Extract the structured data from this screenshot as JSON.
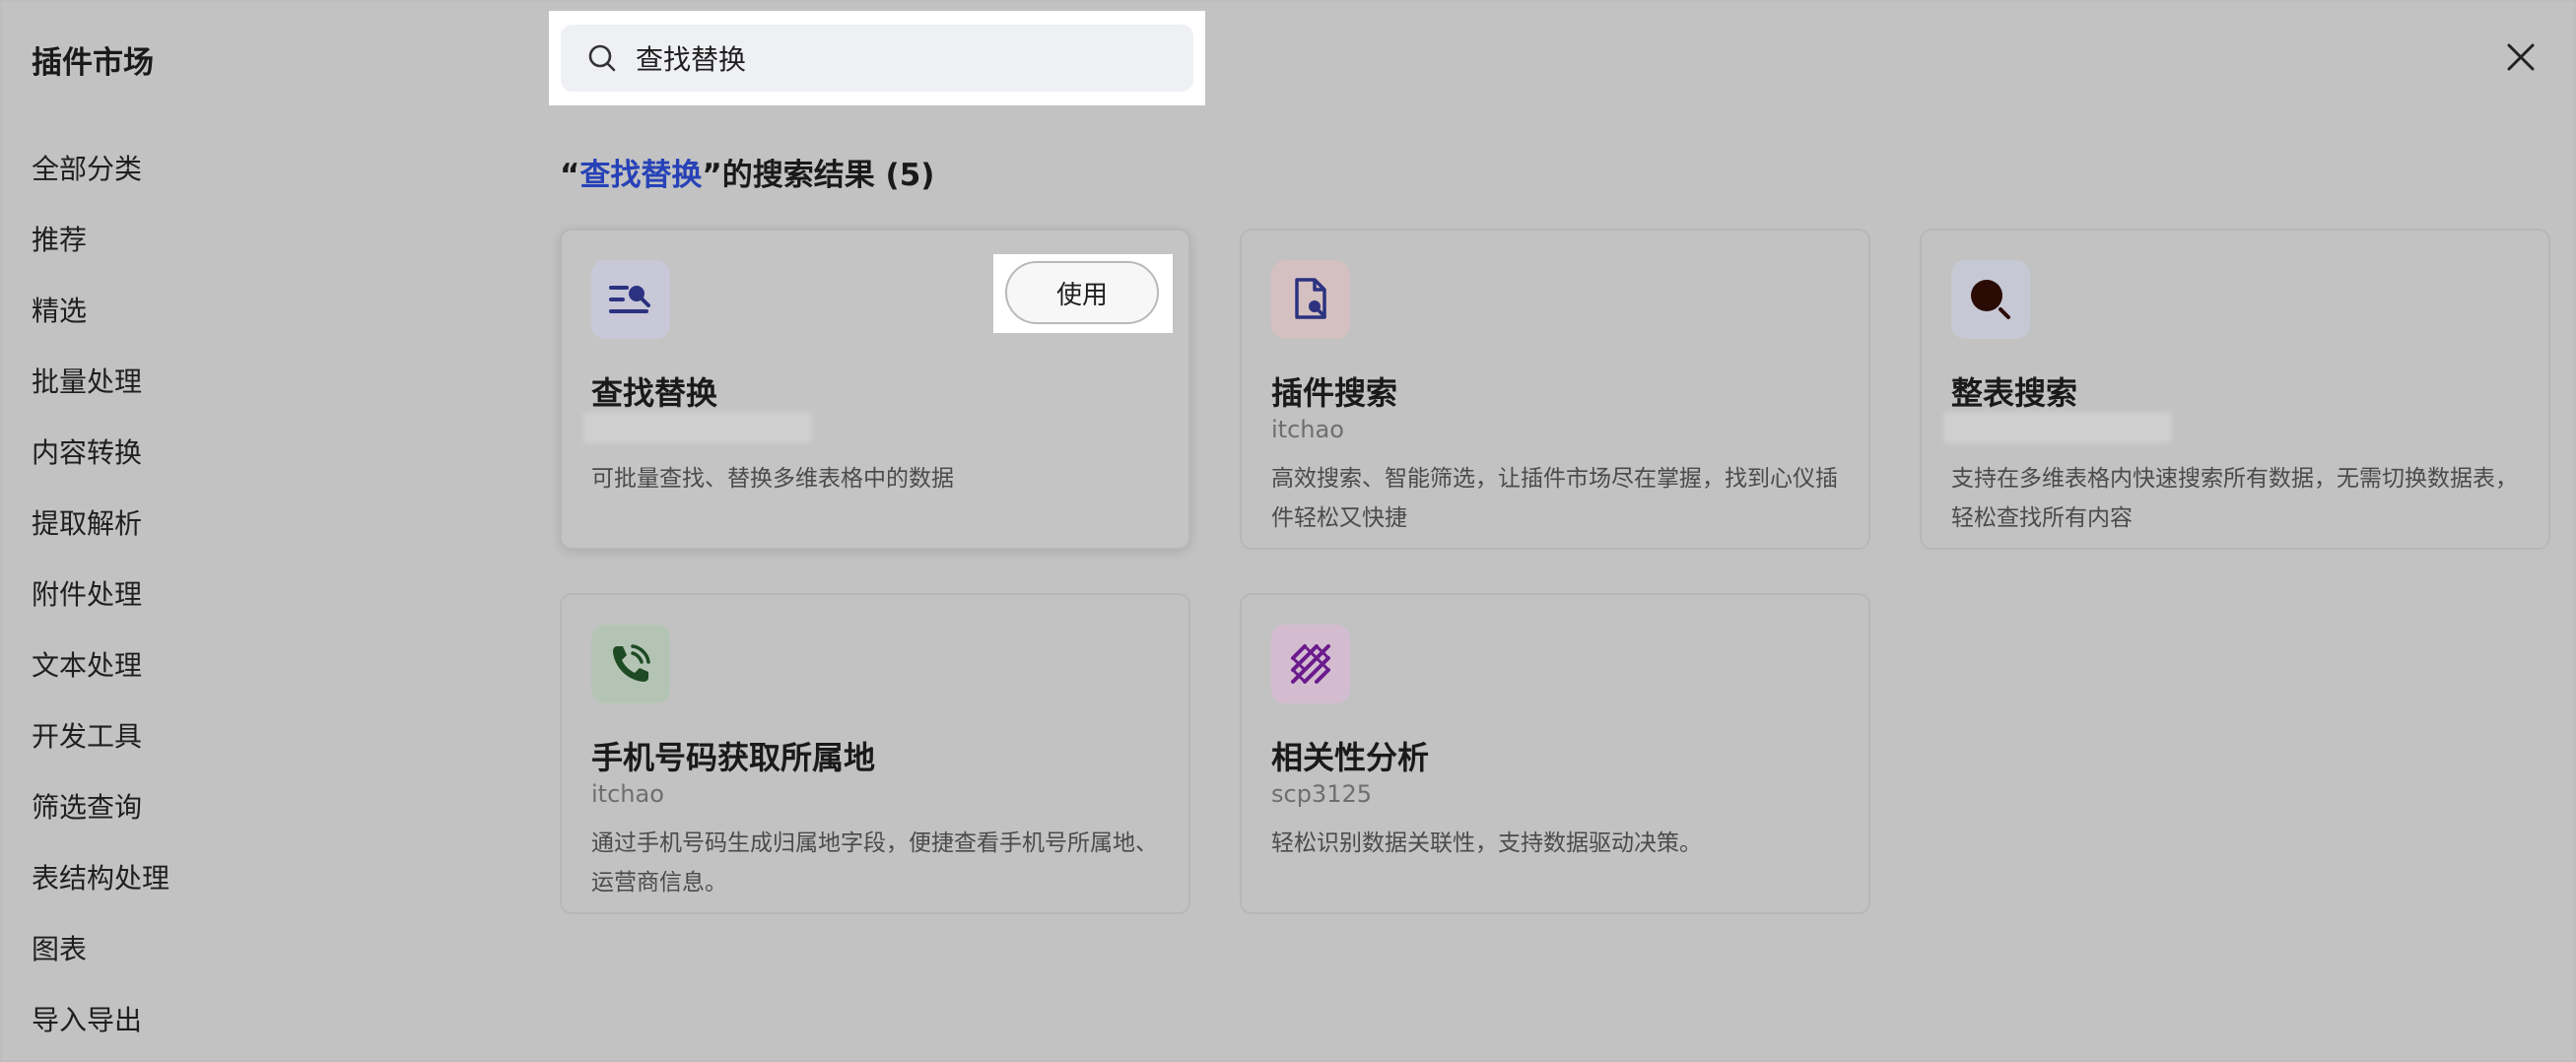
{
  "app": {
    "title": "插件市场"
  },
  "search": {
    "value": "查找替换"
  },
  "sidebar": {
    "items": [
      {
        "label": "全部分类"
      },
      {
        "label": "推荐"
      },
      {
        "label": "精选"
      },
      {
        "label": "批量处理"
      },
      {
        "label": "内容转换"
      },
      {
        "label": "提取解析"
      },
      {
        "label": "附件处理"
      },
      {
        "label": "文本处理"
      },
      {
        "label": "开发工具"
      },
      {
        "label": "筛选查询"
      },
      {
        "label": "表结构处理"
      },
      {
        "label": "图表"
      },
      {
        "label": "导入导出"
      }
    ]
  },
  "results": {
    "open_quote": "“",
    "keyword": "查找替换",
    "suffix": "”的搜索结果 (5)"
  },
  "cards": [
    {
      "title": "查找替换",
      "author": "",
      "description": "可批量查找、替换多维表格中的数据",
      "use_label": "使用",
      "icon": "find-replace-icon",
      "icon_bg": "#c8c8d8",
      "icon_color": "#2c3280"
    },
    {
      "title": "插件搜索",
      "author": "itchao",
      "description": "高效搜索、智能筛选，让插件市场尽在掌握，找到心仪插件轻松又快捷",
      "icon": "document-search-icon",
      "icon_bg": "#d4c0c0",
      "icon_color": "#2c3280"
    },
    {
      "title": "整表搜索",
      "author": "",
      "description": "支持在多维表格内快速搜索所有数据，无需切换数据表，轻松查找所有内容",
      "icon": "magnifier-icon",
      "icon_bg": "#c6c8d4",
      "icon_color": "#2a0c05"
    },
    {
      "title": "手机号码获取所属地",
      "author": "itchao",
      "description": "通过手机号码生成归属地字段，便捷查看手机号所属地、运营商信息。",
      "icon": "phone-call-icon",
      "icon_bg": "#b4c4b4",
      "icon_color": "#1e4a24"
    },
    {
      "title": "相关性分析",
      "author": "scp3125",
      "description": "轻松识别数据关联性，支持数据驱动决策。",
      "icon": "correlation-dots-icon",
      "icon_bg": "#d4bcd0",
      "icon_color": "#6a1a8c"
    }
  ]
}
